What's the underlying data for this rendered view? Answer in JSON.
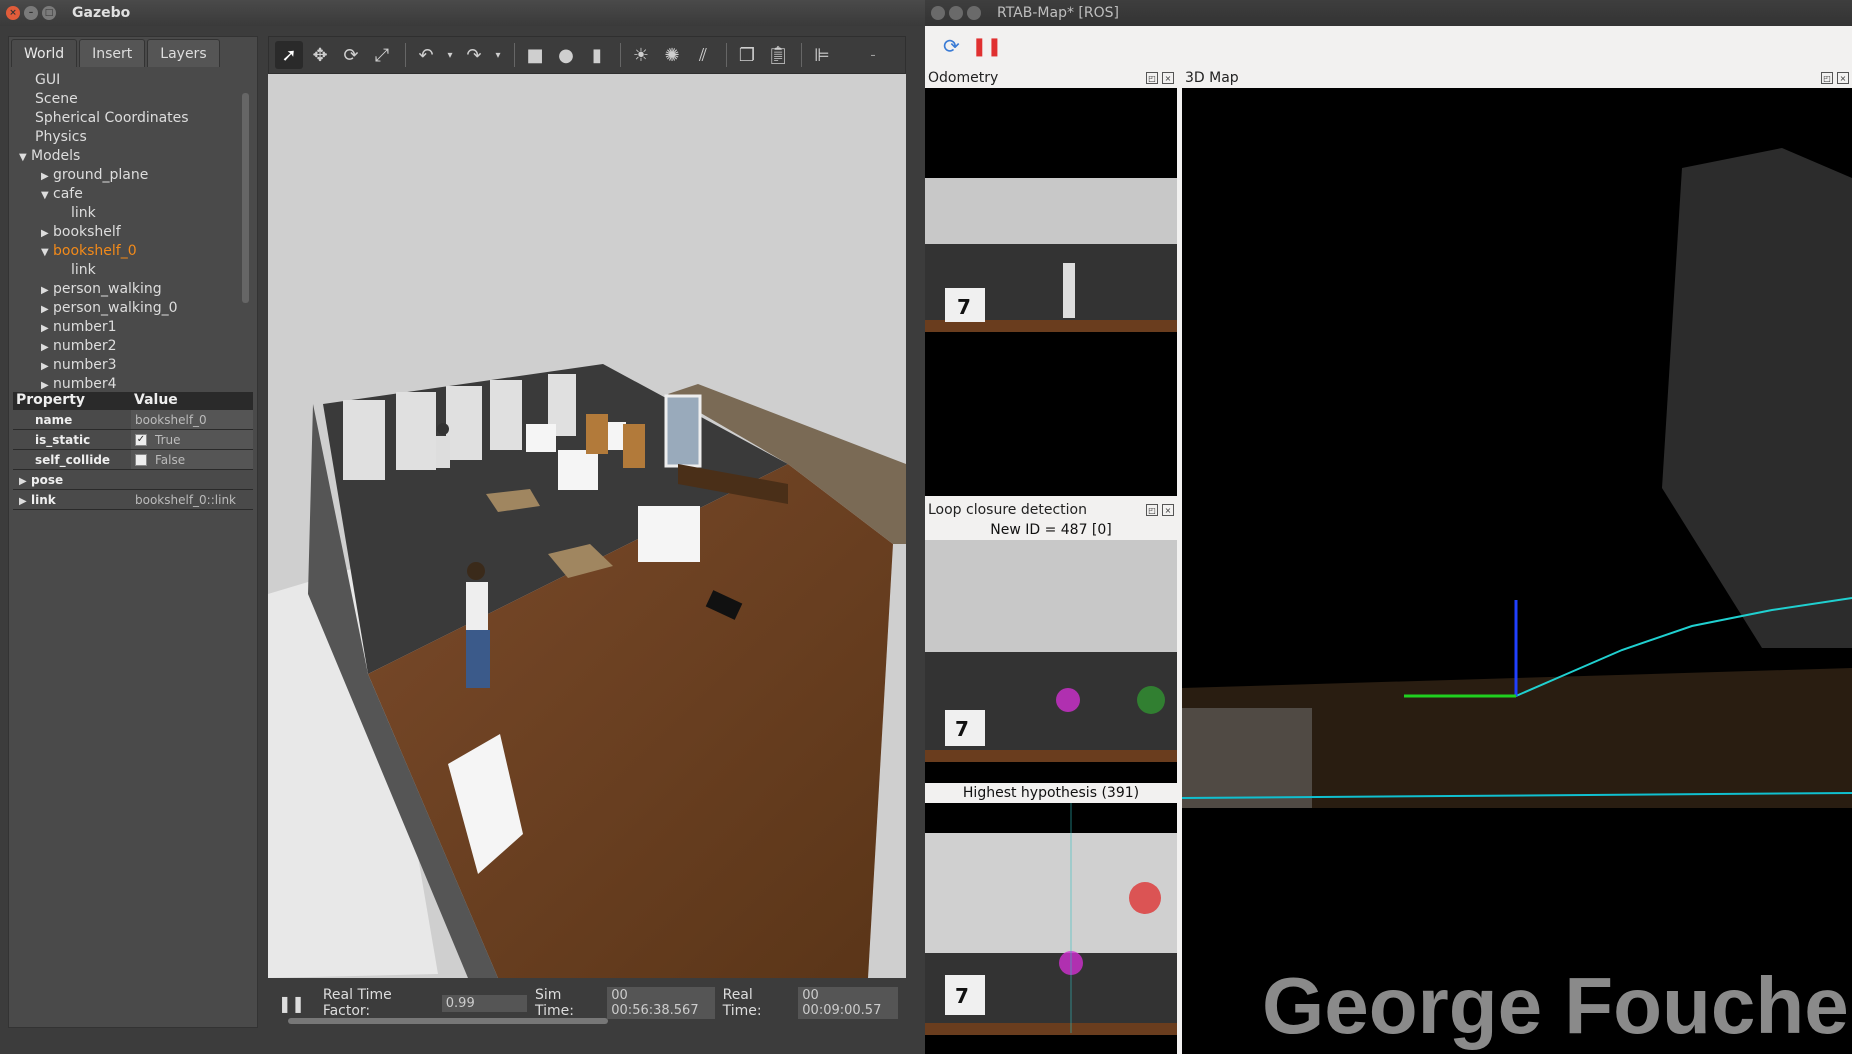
{
  "gazebo": {
    "title": "Gazebo",
    "tabs": [
      "World",
      "Insert",
      "Layers"
    ],
    "tree": [
      {
        "label": "GUI",
        "indent": 0,
        "arrow": ""
      },
      {
        "label": "Scene",
        "indent": 0,
        "arrow": ""
      },
      {
        "label": "Spherical Coordinates",
        "indent": 0,
        "arrow": ""
      },
      {
        "label": "Physics",
        "indent": 0,
        "arrow": ""
      },
      {
        "label": "Models",
        "indent": -1,
        "arrow": "▼"
      },
      {
        "label": "ground_plane",
        "indent": 1,
        "arrow": "▶"
      },
      {
        "label": "cafe",
        "indent": 1,
        "arrow": "▼"
      },
      {
        "label": "link",
        "indent": 2,
        "arrow": ""
      },
      {
        "label": "bookshelf",
        "indent": 1,
        "arrow": "▶"
      },
      {
        "label": "bookshelf_0",
        "indent": 1,
        "arrow": "▼",
        "selected": true
      },
      {
        "label": "link",
        "indent": 2,
        "arrow": ""
      },
      {
        "label": "person_walking",
        "indent": 1,
        "arrow": "▶"
      },
      {
        "label": "person_walking_0",
        "indent": 1,
        "arrow": "▶"
      },
      {
        "label": "number1",
        "indent": 1,
        "arrow": "▶"
      },
      {
        "label": "number2",
        "indent": 1,
        "arrow": "▶"
      },
      {
        "label": "number3",
        "indent": 1,
        "arrow": "▶"
      },
      {
        "label": "number4",
        "indent": 1,
        "arrow": "▶"
      }
    ],
    "properties": {
      "header_property": "Property",
      "header_value": "Value",
      "name_key": "name",
      "name_value": "bookshelf_0",
      "is_static_key": "is_static",
      "is_static_value": "True",
      "self_collide_key": "self_collide",
      "self_collide_value": "False",
      "pose_key": "pose",
      "link_key": "link",
      "link_value": "bookshelf_0::link"
    },
    "status": {
      "rtf_label": "Real Time Factor:",
      "rtf_value": "0.99",
      "sim_label": "Sim Time:",
      "sim_value": "00 00:56:38.567",
      "real_label": "Real Time:",
      "real_value": "00 00:09:00.57"
    },
    "selected_color": "#f28a1a"
  },
  "rtab": {
    "title": "RTAB-Map* [ROS]",
    "odometry_title": "Odometry",
    "loop_title": "Loop closure detection",
    "new_id": "New ID = 487 [0]",
    "highest": "Highest hypothesis (391)",
    "map_title": "3D Map",
    "cube_label": "7"
  },
  "watermark": "George Fouche"
}
